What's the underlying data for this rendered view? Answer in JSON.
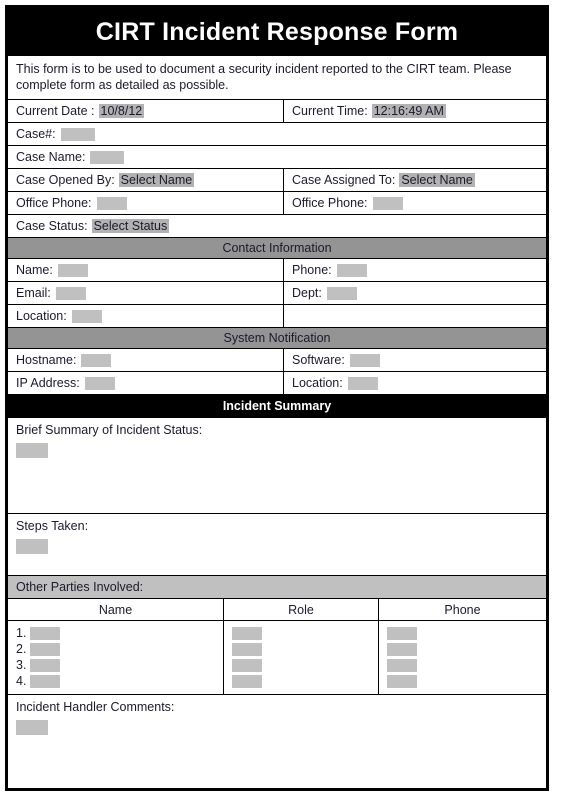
{
  "document": {
    "title": "CIRT Incident Response Form",
    "intro": "This form is to be used to document a security incident reported to the CIRT team. Please complete form as detailed as possible."
  },
  "colors": {
    "title_bar_bg": "#000000",
    "title_bar_text": "#ffffff",
    "section_band_bg": "#949494",
    "section_band_black_bg": "#000000",
    "subsection_band_bg": "#c0c0c0",
    "placeholder_box": "#c0c0c0",
    "value_highlight": "#b2b2b2",
    "border": "#000000"
  },
  "case_header": {
    "current_date_label": "Current Date :",
    "current_date_value": "10/8/12",
    "current_time_label": "Current Time:",
    "current_time_value": "12:16:49 AM",
    "case_number_label": "Case#:",
    "case_name_label": "Case Name:",
    "case_opened_by_label": "Case Opened  By:",
    "case_opened_by_value": "Select Name",
    "case_assigned_to_label": "Case Assigned To:",
    "case_assigned_to_value": "Select Name",
    "office_phone_left_label": "Office Phone:",
    "office_phone_right_label": "Office Phone:",
    "case_status_label": "Case Status:",
    "case_status_value": "Select Status"
  },
  "contact_information": {
    "band": "Contact Information",
    "name_label": "Name:",
    "phone_label": "Phone:",
    "email_label": "Email:",
    "dept_label": "Dept:",
    "location_label": "Location:"
  },
  "system_notification": {
    "band": "System Notification",
    "hostname_label": "Hostname:",
    "software_label": "Software:",
    "ip_address_label": "IP Address:",
    "location_label": "Location:"
  },
  "incident_summary": {
    "band": "Incident Summary",
    "brief_summary_label": "Brief Summary of Incident Status:",
    "steps_taken_label": "Steps Taken:"
  },
  "other_parties": {
    "band": "Other Parties Involved:",
    "columns": [
      "Name",
      "Role",
      "Phone"
    ],
    "rows": [
      {
        "number": "1.",
        "name": "",
        "role": "",
        "phone": ""
      },
      {
        "number": "2.",
        "name": "",
        "role": "",
        "phone": ""
      },
      {
        "number": "3.",
        "name": "",
        "role": "",
        "phone": ""
      },
      {
        "number": "4.",
        "name": "",
        "role": "",
        "phone": ""
      }
    ]
  },
  "incident_handler": {
    "comments_label": "Incident Handler Comments:"
  }
}
